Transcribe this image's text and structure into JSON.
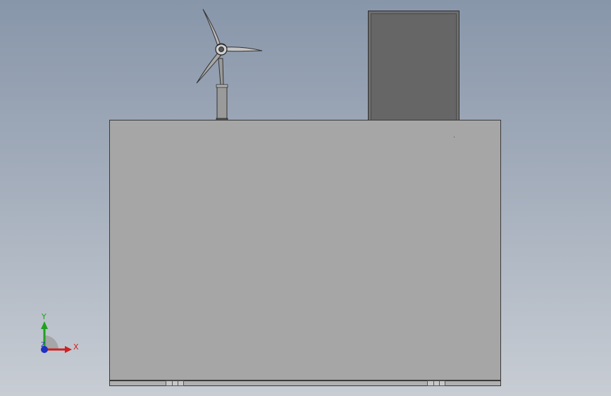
{
  "triad": {
    "x_label": "X",
    "y_label": "Y",
    "z_label": "Z",
    "colors": {
      "x": "#d02020",
      "y": "#20a020",
      "z": "#2030c0"
    }
  },
  "scene": {
    "background_colors": [
      "#8896aa",
      "#c8cdd4"
    ],
    "enclosure_color": "#a6a6a6",
    "panel_color": "#6e6e6e"
  }
}
